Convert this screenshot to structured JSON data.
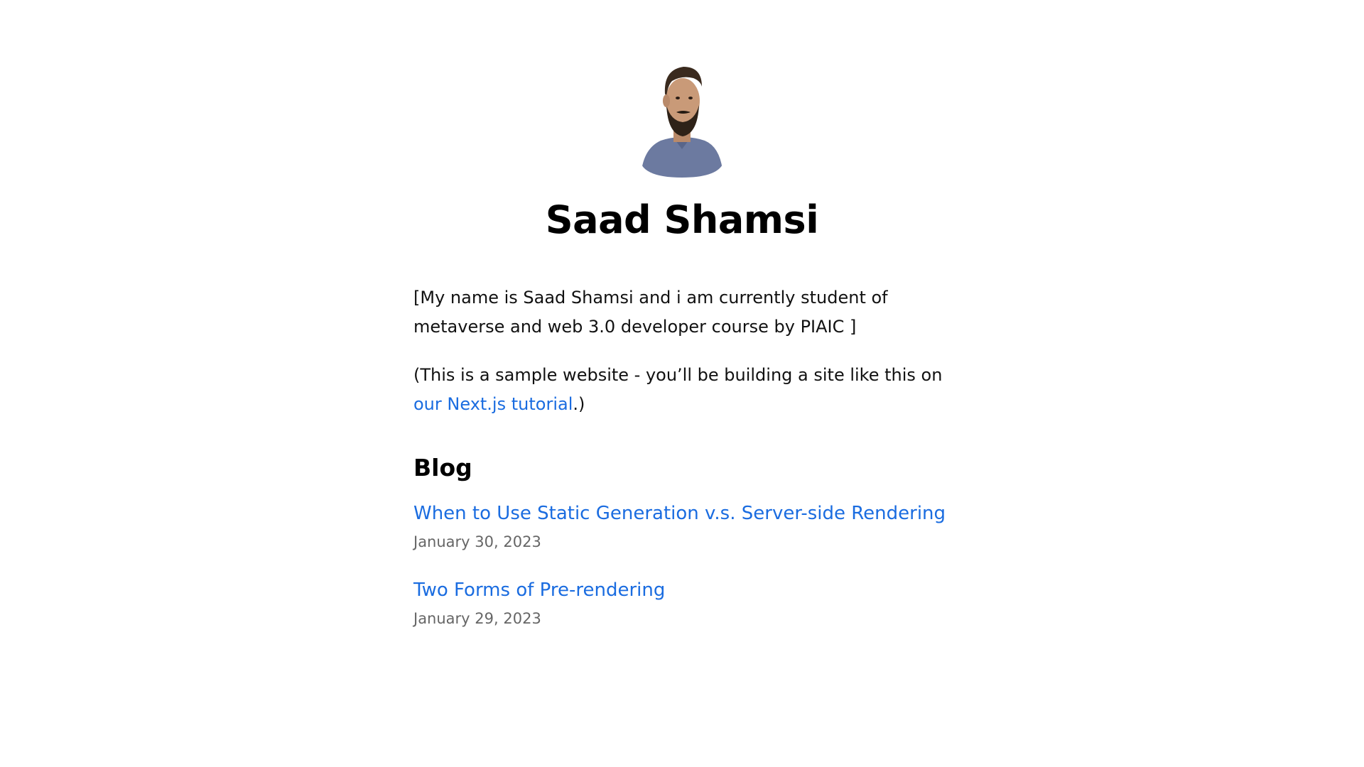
{
  "header": {
    "name": "Saad Shamsi",
    "avatar_icon": "profile-photo"
  },
  "intro": {
    "bio": "[My name is Saad Shamsi and i am currently student of metaverse and web 3.0 developer course by PIAIC ]",
    "note_prefix": "(This is a sample website - you’ll be building a site like this on ",
    "note_link": "our Next.js tutorial",
    "note_suffix": ".)"
  },
  "blog": {
    "heading": "Blog",
    "posts": [
      {
        "title": "When to Use Static Generation v.s. Server-side Rendering",
        "date": "January 30, 2023"
      },
      {
        "title": "Two Forms of Pre-rendering",
        "date": "January 29, 2023"
      }
    ]
  },
  "colors": {
    "link": "#1a6ce0",
    "date": "#666666",
    "text": "#111111"
  }
}
